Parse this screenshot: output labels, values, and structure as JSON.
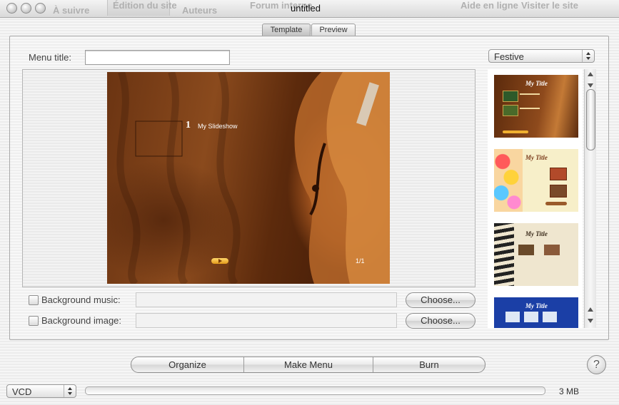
{
  "titlebar": {
    "title": "untitled",
    "items": [
      {
        "label": "À suivre"
      },
      {
        "label": "Édition du site"
      },
      {
        "label": "Auteurs"
      },
      {
        "label": "Forum interne"
      },
      {
        "label": "Aide en ligne"
      },
      {
        "label": "Visiter le site"
      }
    ]
  },
  "tabs": [
    {
      "label": "Template",
      "active": true
    },
    {
      "label": "Preview",
      "active": false
    }
  ],
  "menu_title": {
    "label": "Menu title:",
    "value": ""
  },
  "theme_popup": {
    "value": "Festive"
  },
  "preview": {
    "item_number": "1",
    "item_label": "My Slideshow",
    "page_indicator": "1/1"
  },
  "background_music": {
    "label": "Background music:",
    "value": "",
    "checked": false,
    "button": "Choose..."
  },
  "background_image": {
    "label": "Background image:",
    "value": "",
    "checked": false,
    "button": "Choose..."
  },
  "templates": [
    {
      "title": "My Title",
      "style": "violin"
    },
    {
      "title": "My Title",
      "style": "balloons"
    },
    {
      "title": "My Title",
      "style": "piano"
    },
    {
      "title": "My Title",
      "style": "winter"
    }
  ],
  "actions": {
    "organize": "Organize",
    "make_menu": "Make Menu",
    "burn": "Burn",
    "help": "?"
  },
  "status": {
    "format": "VCD",
    "size": "3 MB",
    "progress": 0
  },
  "colors": {
    "accent_button": "#f0b030",
    "winter_blue": "#1b3fa6"
  }
}
